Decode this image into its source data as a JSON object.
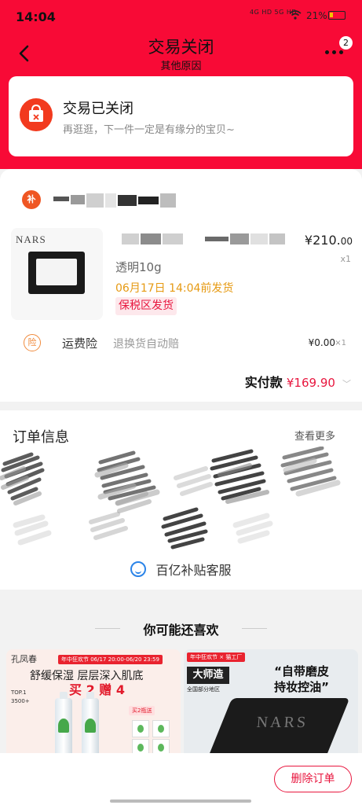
{
  "status_bar": {
    "time": "14:04",
    "signal": "4G HD 5G HD",
    "battery_pct": "21%"
  },
  "nav": {
    "title": "交易关闭",
    "subtitle": "其他原因",
    "more_badge": "2"
  },
  "status_card": {
    "title": "交易已关闭",
    "desc": "再逛逛，下一件一定是有缘分的宝贝~"
  },
  "shop": {
    "icon_text": "补"
  },
  "product": {
    "brand": "NARS",
    "spec": "透明10g",
    "ship": "06月17日 14:04前发货",
    "tag": "保税区发货",
    "price_main": "¥210.",
    "price_cents": "00",
    "qty": "x1"
  },
  "insurance": {
    "icon_text": "险",
    "label": "运费险",
    "desc": "退换货自动赔",
    "price": "¥0.00",
    "qty": "×1"
  },
  "payment": {
    "label": "实付款",
    "amount": "¥169.90"
  },
  "order_info": {
    "title": "订单信息",
    "more": "查看更多",
    "service": "百亿补贴客服"
  },
  "recommend": {
    "title": "你可能还喜欢",
    "left": {
      "brand": "孔凤春",
      "banner": "年中狂欢节  06/17 20:00-06/20 23:59",
      "slogan1": "舒缓保湿 层层深入肌底",
      "slogan2": "买 2 赠 4",
      "side1": "TOP.1",
      "side2": "3500+",
      "box_tag": "买2瓶送"
    },
    "right": {
      "banner": "年中狂欢节 × 猫工厂",
      "logo": "大师造",
      "region": "全国部分地区",
      "quote_line1": "“自带磨皮",
      "quote_line2": "持妆控油”"
    }
  },
  "bottom": {
    "delete_label": "删除订单"
  },
  "colors": {
    "brand_red": "#f80a36",
    "price_red": "#e8163e",
    "ship_orange": "#e69a13"
  }
}
